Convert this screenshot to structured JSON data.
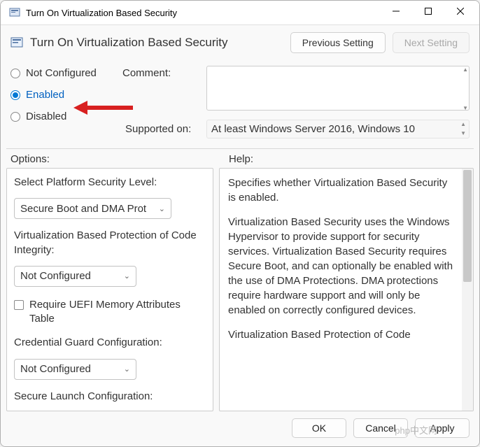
{
  "titlebar": {
    "title": "Turn On Virtualization Based Security"
  },
  "header": {
    "title": "Turn On Virtualization Based Security",
    "prev_label": "Previous Setting",
    "next_label": "Next Setting"
  },
  "state_radios": {
    "not_configured": "Not Configured",
    "enabled": "Enabled",
    "disabled": "Disabled"
  },
  "comment": {
    "label": "Comment:",
    "value": ""
  },
  "supported": {
    "label": "Supported on:",
    "value": "At least Windows Server 2016, Windows 10"
  },
  "options": {
    "header": "Options:",
    "platform_label": "Select Platform Security Level:",
    "platform_value": "Secure Boot and DMA Prot",
    "vbpci_label": "Virtualization Based Protection of Code Integrity:",
    "vbpci_value": "Not Configured",
    "uefi_checkbox": "Require UEFI Memory Attributes Table",
    "credguard_label": "Credential Guard Configuration:",
    "credguard_value": "Not Configured",
    "securelaunch_label": "Secure Launch Configuration:"
  },
  "help": {
    "header": "Help:",
    "p1": "Specifies whether Virtualization Based Security is enabled.",
    "p2": "Virtualization Based Security uses the Windows Hypervisor to provide support for security services. Virtualization Based Security requires Secure Boot, and can optionally be enabled with the use of DMA Protections. DMA protections require hardware support and will only be enabled on correctly configured devices.",
    "p3": "Virtualization Based Protection of Code"
  },
  "footer": {
    "ok": "OK",
    "cancel": "Cancel",
    "apply": "Apply"
  },
  "watermark": "php中文网"
}
